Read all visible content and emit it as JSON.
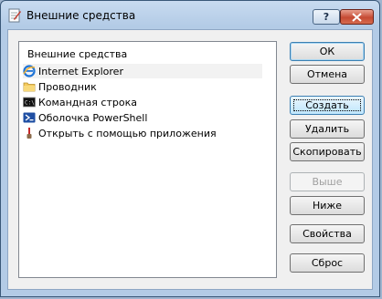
{
  "window": {
    "title": "Внешние средства",
    "help_label": "?",
    "close_label": "X"
  },
  "list": {
    "header": "Внешние средства",
    "items": [
      {
        "label": "Internet Explorer",
        "icon": "internet-explorer-icon",
        "selected": true
      },
      {
        "label": "Проводник",
        "icon": "explorer-folder-icon",
        "selected": false
      },
      {
        "label": "Командная строка",
        "icon": "command-prompt-icon",
        "selected": false
      },
      {
        "label": "Оболочка PowerShell",
        "icon": "powershell-icon",
        "selected": false
      },
      {
        "label": "Открыть с помощью приложения",
        "icon": "open-with-icon",
        "selected": false
      }
    ]
  },
  "buttons": {
    "ok": "ОК",
    "cancel": "Отмена",
    "create": "Создать",
    "delete": "Удалить",
    "copy": "Скопировать",
    "up": "Выше",
    "down": "Ниже",
    "properties": "Свойства",
    "reset": "Сброс"
  },
  "colors": {
    "title_gradient": "#b3cbe6",
    "close_button": "#c64a33",
    "focus_button": "#bee6fd",
    "disabled_text": "#a0a0a0"
  }
}
